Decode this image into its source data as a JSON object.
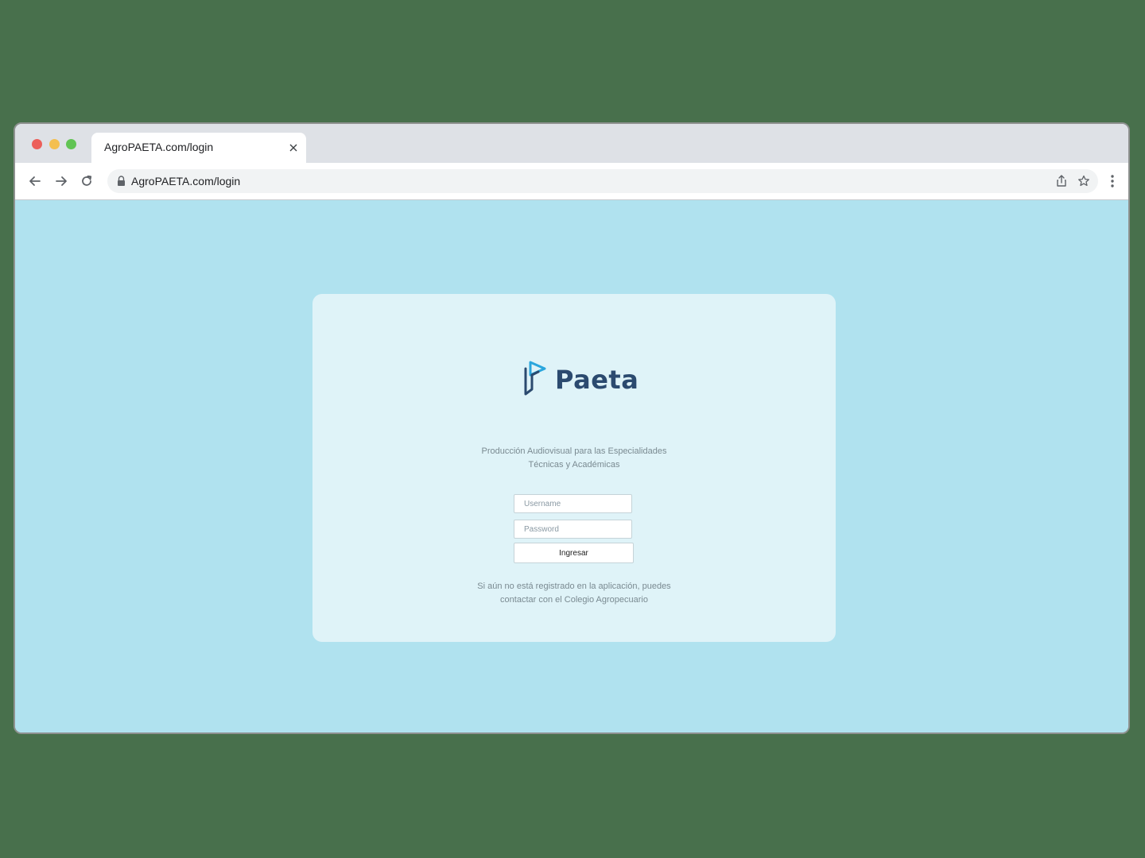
{
  "browser": {
    "tab_title": "AgroPAETA.com/login",
    "url": "AgroPAETA.com/login"
  },
  "icons": {
    "traffic_close": "red-dot-icon",
    "traffic_minimize": "yellow-dot-icon",
    "traffic_maximize": "green-dot-icon",
    "tab_close": "close-icon",
    "back": "arrow-left-icon",
    "forward": "arrow-right-icon",
    "reload": "reload-icon",
    "lock": "lock-icon",
    "share": "share-icon",
    "bookmark": "star-icon",
    "menu": "kebab-menu-icon"
  },
  "login": {
    "brand": "Paeta",
    "tagline_line1": "Producción Audiovisual para las Especialidades",
    "tagline_line2": "Técnicas y Académicas",
    "username_placeholder": "Username",
    "username_value": "",
    "password_placeholder": "Password",
    "password_value": "",
    "submit_label": "Ingresar",
    "footnote_line1": "Si aún no está registrado en la aplicación, puedes",
    "footnote_line2": "contactar con el Colegio Agropecuario"
  },
  "colors": {
    "page_background": "#48704c",
    "content_background": "#b0e2ef",
    "card_background": "#dff3f8",
    "brand_text": "#2b4a6f",
    "brand_accent": "#2aa6dd"
  }
}
